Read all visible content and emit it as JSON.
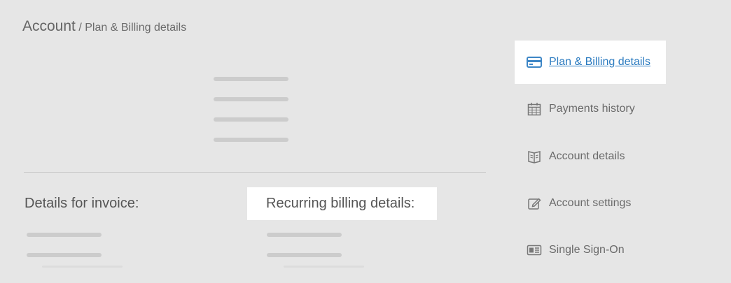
{
  "breadcrumb": {
    "root": "Account",
    "separator": "/",
    "current": "Plan & Billing details"
  },
  "sections": {
    "invoice_title": "Details for invoice:",
    "recurring_title": "Recurring billing details:"
  },
  "sidebar": {
    "items": [
      {
        "label": "Plan & Billing details",
        "icon": "credit-card-icon",
        "active": true
      },
      {
        "label": "Payments history",
        "icon": "calendar-icon",
        "active": false
      },
      {
        "label": "Account details",
        "icon": "book-icon",
        "active": false
      },
      {
        "label": "Account settings",
        "icon": "edit-icon",
        "active": false
      },
      {
        "label": "Single Sign-On",
        "icon": "id-card-icon",
        "active": false
      }
    ]
  },
  "colors": {
    "background": "#e6e6e6",
    "panel": "#ffffff",
    "link": "#2b7bc0",
    "text": "#6a6a6a",
    "placeholder": "#cccccc"
  }
}
